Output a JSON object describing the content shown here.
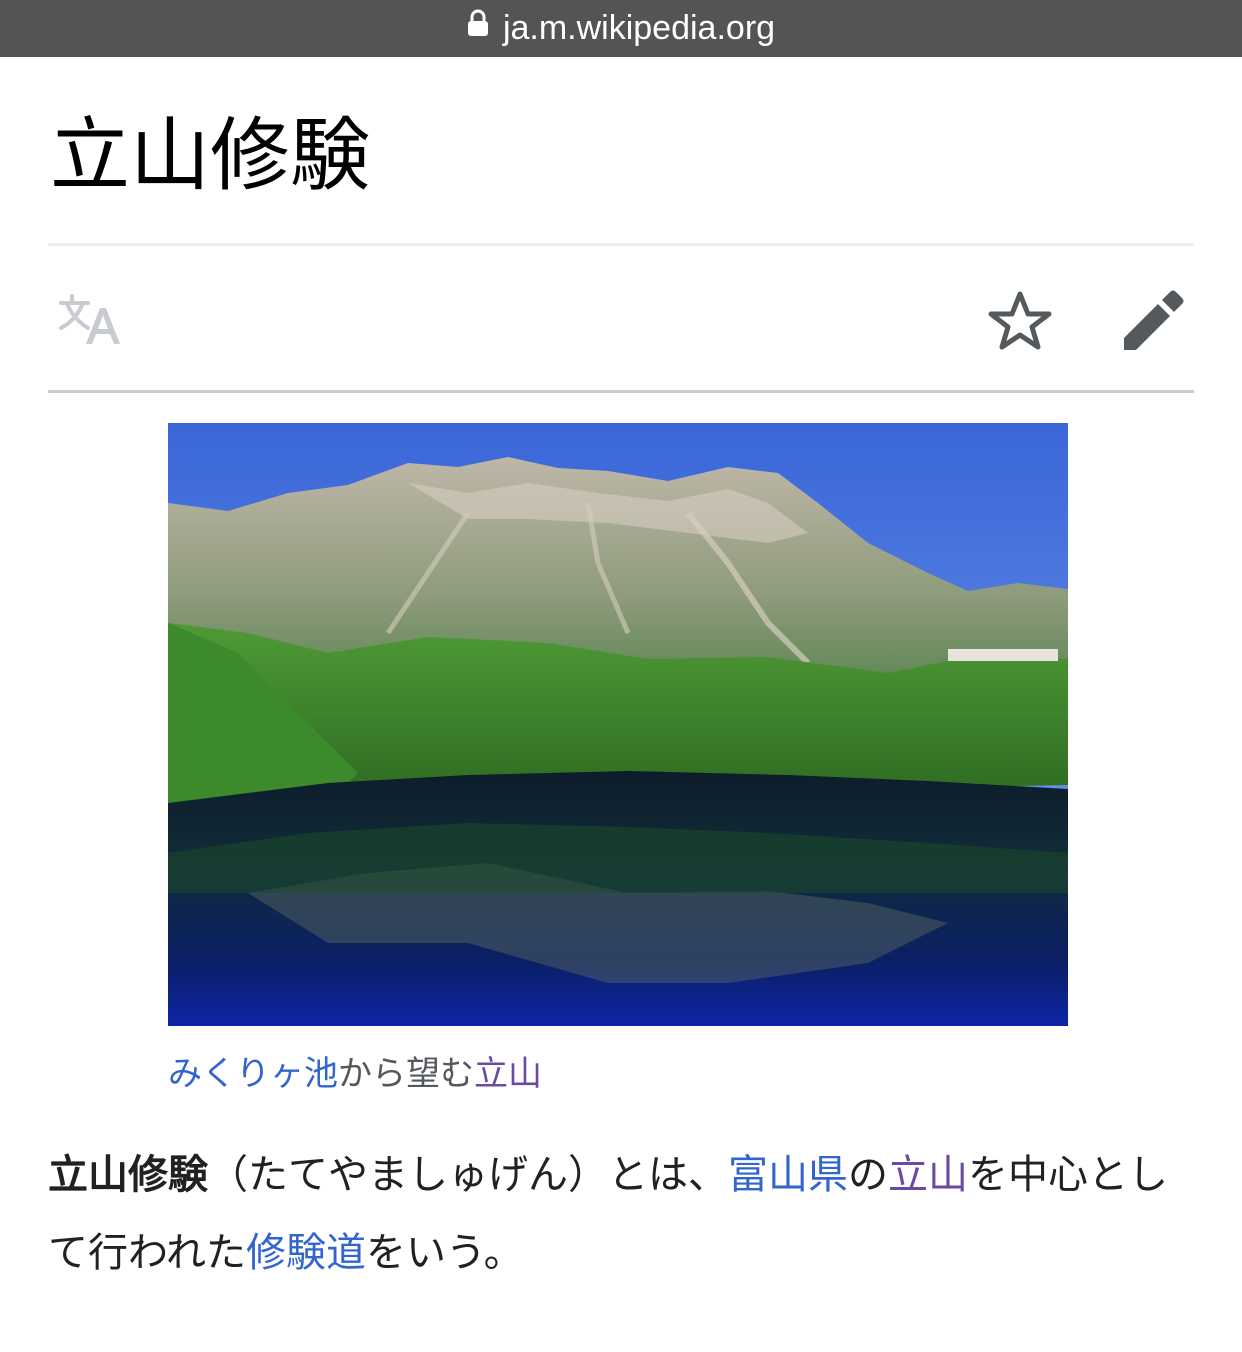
{
  "browser": {
    "url": "ja.m.wikipedia.org"
  },
  "article": {
    "title": "立山修験"
  },
  "toolbar": {
    "icons": [
      "language-icon",
      "watch-star-icon",
      "edit-pencil-icon"
    ]
  },
  "figure": {
    "caption": {
      "link1": "みくりヶ池",
      "text1": "から望む",
      "link2": "立山"
    }
  },
  "body": {
    "bold": "立山修験",
    "t1": "（たてやましゅげん）とは、",
    "link1": "富山県",
    "t2": "の",
    "link2": "立山",
    "t3": "を中心として行われた",
    "link3": "修験道",
    "t4": "をいう。"
  },
  "colors": {
    "link": "#3366cc",
    "visited_link": "#6b4ba1",
    "url_bar": "#535456"
  }
}
